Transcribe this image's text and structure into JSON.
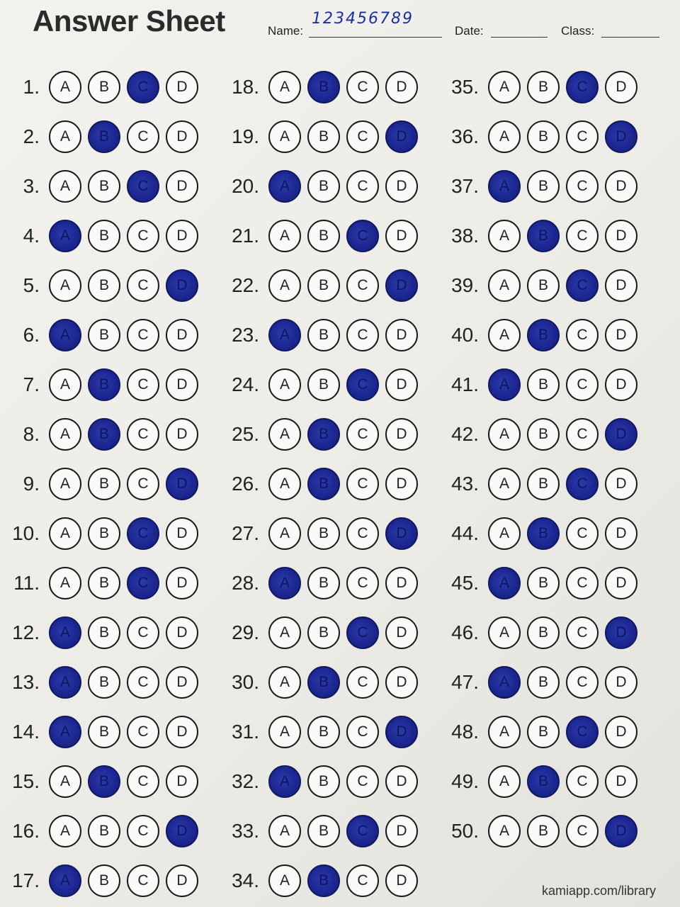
{
  "header": {
    "title": "Answer Sheet",
    "name_label": "Name:",
    "name_value": "123456789",
    "date_label": "Date:",
    "class_label": "Class:"
  },
  "options": [
    "A",
    "B",
    "C",
    "D"
  ],
  "questions": [
    {
      "num": "1.",
      "answer": "C"
    },
    {
      "num": "2.",
      "answer": "B"
    },
    {
      "num": "3.",
      "answer": "C"
    },
    {
      "num": "4.",
      "answer": "A"
    },
    {
      "num": "5.",
      "answer": "D"
    },
    {
      "num": "6.",
      "answer": "A"
    },
    {
      "num": "7.",
      "answer": "B"
    },
    {
      "num": "8.",
      "answer": "B"
    },
    {
      "num": "9.",
      "answer": "D"
    },
    {
      "num": "10.",
      "answer": "C"
    },
    {
      "num": "11.",
      "answer": "C"
    },
    {
      "num": "12.",
      "answer": "A"
    },
    {
      "num": "13.",
      "answer": "A"
    },
    {
      "num": "14.",
      "answer": "A"
    },
    {
      "num": "15.",
      "answer": "B"
    },
    {
      "num": "16.",
      "answer": "D"
    },
    {
      "num": "17.",
      "answer": "A"
    },
    {
      "num": "18.",
      "answer": "B"
    },
    {
      "num": "19.",
      "answer": "D"
    },
    {
      "num": "20.",
      "answer": "A"
    },
    {
      "num": "21.",
      "answer": "C"
    },
    {
      "num": "22.",
      "answer": "D"
    },
    {
      "num": "23.",
      "answer": "A"
    },
    {
      "num": "24.",
      "answer": "C"
    },
    {
      "num": "25.",
      "answer": "B"
    },
    {
      "num": "26.",
      "answer": "B"
    },
    {
      "num": "27.",
      "answer": "D"
    },
    {
      "num": "28.",
      "answer": "A"
    },
    {
      "num": "29.",
      "answer": "C"
    },
    {
      "num": "30.",
      "answer": "B"
    },
    {
      "num": "31.",
      "answer": "D"
    },
    {
      "num": "32.",
      "answer": "A"
    },
    {
      "num": "33.",
      "answer": "C"
    },
    {
      "num": "34.",
      "answer": "B"
    },
    {
      "num": "35.",
      "answer": "C"
    },
    {
      "num": "36.",
      "answer": "D"
    },
    {
      "num": "37.",
      "answer": "A"
    },
    {
      "num": "38.",
      "answer": "B"
    },
    {
      "num": "39.",
      "answer": "C"
    },
    {
      "num": "40.",
      "answer": "B"
    },
    {
      "num": "41.",
      "answer": "A"
    },
    {
      "num": "42.",
      "answer": "D"
    },
    {
      "num": "43.",
      "answer": "C"
    },
    {
      "num": "44.",
      "answer": "B"
    },
    {
      "num": "45.",
      "answer": "A"
    },
    {
      "num": "46.",
      "answer": "D"
    },
    {
      "num": "47.",
      "answer": "A"
    },
    {
      "num": "48.",
      "answer": "C"
    },
    {
      "num": "49.",
      "answer": "B"
    },
    {
      "num": "50.",
      "answer": "D"
    }
  ],
  "footer": {
    "text": "kamiapp.com/library"
  },
  "colors": {
    "fill": "#1c2792",
    "ink": "#1c2da6"
  }
}
